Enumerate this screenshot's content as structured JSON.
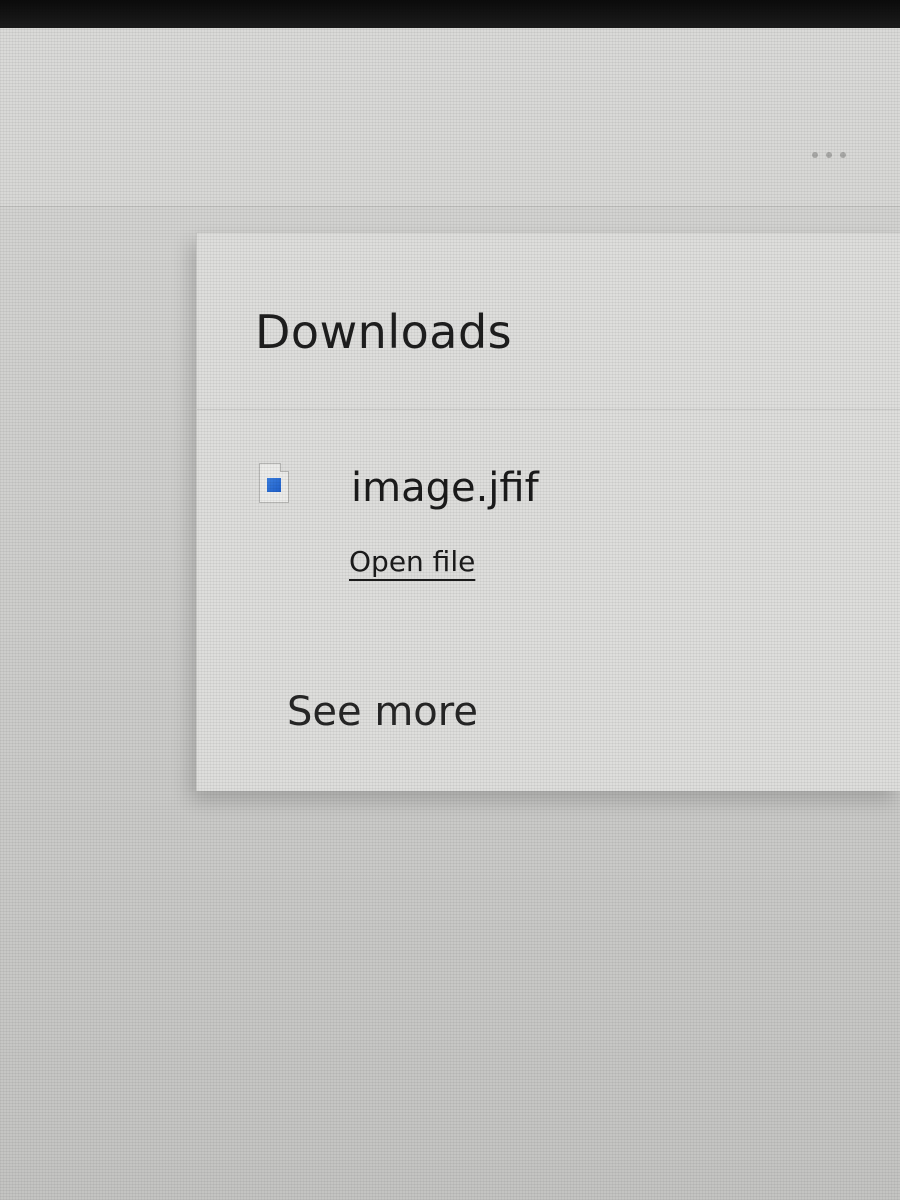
{
  "toolbar": {
    "more_icon": "more-horizontal-icon"
  },
  "downloads": {
    "title": "Downloads",
    "items": [
      {
        "file_name": "image.jfif",
        "action_label": "Open file",
        "icon": "image-file-icon"
      }
    ],
    "see_more_label": "See more"
  },
  "colors": {
    "panel_background": "#dededc",
    "text": "#1e1e1e",
    "image_icon_blue": "#2f6fd6"
  }
}
